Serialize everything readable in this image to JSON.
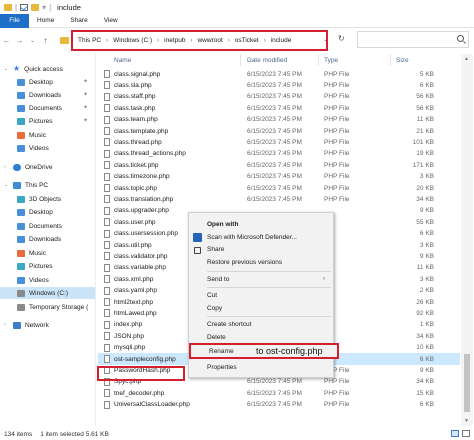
{
  "window": {
    "title": "include"
  },
  "ribbon": {
    "tabs": [
      "File",
      "Home",
      "Share",
      "View"
    ]
  },
  "address": {
    "crumbs": [
      "This PC",
      "Windows (C:)",
      "inetpub",
      "wwwroot",
      "osTicket",
      "include"
    ]
  },
  "nav": {
    "items": [
      {
        "label": "Quick access",
        "icon": "star-icon"
      },
      {
        "label": "Desktop",
        "icon": "desktop-icon",
        "pinned": true
      },
      {
        "label": "Downloads",
        "icon": "downloads-icon",
        "pinned": true
      },
      {
        "label": "Documents",
        "icon": "documents-icon",
        "pinned": true
      },
      {
        "label": "Pictures",
        "icon": "pictures-icon",
        "pinned": true
      },
      {
        "label": "Music",
        "icon": "music-icon"
      },
      {
        "label": "Videos",
        "icon": "videos-icon"
      },
      {
        "label": "OneDrive",
        "icon": "onedrive-icon"
      },
      {
        "label": "This PC",
        "icon": "pc-icon"
      },
      {
        "label": "3D Objects",
        "icon": "3d-objects-icon"
      },
      {
        "label": "Desktop",
        "icon": "desktop-icon"
      },
      {
        "label": "Documents",
        "icon": "documents-icon"
      },
      {
        "label": "Downloads",
        "icon": "downloads-icon"
      },
      {
        "label": "Music",
        "icon": "music-icon"
      },
      {
        "label": "Pictures",
        "icon": "pictures-icon"
      },
      {
        "label": "Videos",
        "icon": "videos-icon"
      },
      {
        "label": "Windows (C:)",
        "icon": "drive-icon"
      },
      {
        "label": "Temporary Storage (",
        "icon": "drive-icon"
      },
      {
        "label": "Network",
        "icon": "network-icon"
      }
    ]
  },
  "columns": {
    "name": "Name",
    "date": "Date modified",
    "type": "Type",
    "size": "Size"
  },
  "files": [
    {
      "name": "class.signal.php",
      "date": "6/15/2023 7:45 PM",
      "type": "PHP File",
      "size": "5 KB"
    },
    {
      "name": "class.sla.php",
      "date": "6/15/2023 7:45 PM",
      "type": "PHP File",
      "size": "6 KB"
    },
    {
      "name": "class.staff.php",
      "date": "6/15/2023 7:45 PM",
      "type": "PHP File",
      "size": "56 KB"
    },
    {
      "name": "class.task.php",
      "date": "6/15/2023 7:45 PM",
      "type": "PHP File",
      "size": "56 KB"
    },
    {
      "name": "class.team.php",
      "date": "6/15/2023 7:45 PM",
      "type": "PHP File",
      "size": "11 KB"
    },
    {
      "name": "class.template.php",
      "date": "6/15/2023 7:45 PM",
      "type": "PHP File",
      "size": "21 KB"
    },
    {
      "name": "class.thread.php",
      "date": "6/15/2023 7:45 PM",
      "type": "PHP File",
      "size": "101 KB"
    },
    {
      "name": "class.thread_actions.php",
      "date": "6/15/2023 7:45 PM",
      "type": "PHP File",
      "size": "19 KB"
    },
    {
      "name": "class.ticket.php",
      "date": "6/15/2023 7:45 PM",
      "type": "PHP File",
      "size": "171 KB"
    },
    {
      "name": "class.timezone.php",
      "date": "6/15/2023 7:45 PM",
      "type": "PHP File",
      "size": "3 KB"
    },
    {
      "name": "class.topic.php",
      "date": "6/15/2023 7:45 PM",
      "type": "PHP File",
      "size": "20 KB"
    },
    {
      "name": "class.translation.php",
      "date": "6/15/2023 7:45 PM",
      "type": "PHP File",
      "size": "34 KB"
    },
    {
      "name": "class.upgrader.php",
      "date": "",
      "type": "",
      "size": "9 KB"
    },
    {
      "name": "class.user.php",
      "date": "",
      "type": "",
      "size": "55 KB"
    },
    {
      "name": "class.usersession.php",
      "date": "",
      "type": "",
      "size": "6 KB"
    },
    {
      "name": "class.util.php",
      "date": "",
      "type": "",
      "size": "3 KB"
    },
    {
      "name": "class.validator.php",
      "date": "",
      "type": "",
      "size": "9 KB"
    },
    {
      "name": "class.variable.php",
      "date": "",
      "type": "",
      "size": "11 KB"
    },
    {
      "name": "class.xml.php",
      "date": "",
      "type": "",
      "size": "3 KB"
    },
    {
      "name": "class.yaml.php",
      "date": "",
      "type": "",
      "size": "2 KB"
    },
    {
      "name": "html2text.php",
      "date": "",
      "type": "",
      "size": "26 KB"
    },
    {
      "name": "htmLawed.php",
      "date": "",
      "type": "",
      "size": "92 KB"
    },
    {
      "name": "index.php",
      "date": "",
      "type": "",
      "size": "1 KB"
    },
    {
      "name": "JSON.php",
      "date": "",
      "type": "",
      "size": "34 KB"
    },
    {
      "name": "mysqli.php",
      "date": "",
      "type": "",
      "size": "10 KB"
    },
    {
      "name": "ost-sampleconfig.php",
      "date": "",
      "type": "",
      "size": "6 KB",
      "selected": true
    },
    {
      "name": "PasswordHash.php",
      "date": "6/15/2023 7:45 PM",
      "type": "PHP File",
      "size": "9 KB"
    },
    {
      "name": "Spyc.php",
      "date": "6/15/2023 7:45 PM",
      "type": "PHP File",
      "size": "34 KB"
    },
    {
      "name": "tnef_decoder.php",
      "date": "6/15/2023 7:45 PM",
      "type": "PHP File",
      "size": "15 KB"
    },
    {
      "name": "UniversalClassLoader.php",
      "date": "6/15/2023 7:45 PM",
      "type": "PHP File",
      "size": "6 KB"
    }
  ],
  "context_menu": {
    "open_with": "Open with",
    "scan": "Scan with Microsoft Defender...",
    "share": "Share",
    "restore": "Restore previous versions",
    "send_to": "Send to",
    "cut": "Cut",
    "copy": "Copy",
    "create_shortcut": "Create shortcut",
    "delete": "Delete",
    "rename": "Rename",
    "rename_annotation": "to ost-config.php",
    "properties": "Properties"
  },
  "status": {
    "item_count": "134 items",
    "selection": "1 item selected  5.61 KB"
  },
  "colors": {
    "highlight_red": "#d3202f",
    "file_tab_blue": "#1e6fc8",
    "selection_blue": "#cce8ff"
  }
}
